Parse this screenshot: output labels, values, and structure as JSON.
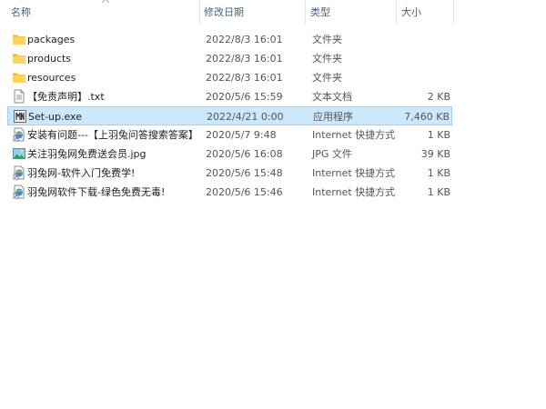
{
  "columns": {
    "name": "名称",
    "modified": "修改日期",
    "type": "类型",
    "size": "大小"
  },
  "files": [
    {
      "name": "packages",
      "modified": "2022/8/3 16:01",
      "type": "文件夹",
      "size": "",
      "icon": "folder-icon",
      "selected": false
    },
    {
      "name": "products",
      "modified": "2022/8/3 16:01",
      "type": "文件夹",
      "size": "",
      "icon": "folder-icon",
      "selected": false
    },
    {
      "name": "resources",
      "modified": "2022/8/3 16:01",
      "type": "文件夹",
      "size": "",
      "icon": "folder-icon",
      "selected": false
    },
    {
      "name": "【免责声明】.txt",
      "modified": "2020/5/6 15:59",
      "type": "文本文档",
      "size": "2 KB",
      "icon": "text-file-icon",
      "selected": false
    },
    {
      "name": "Set-up.exe",
      "modified": "2022/4/21 0:00",
      "type": "应用程序",
      "size": "7,460 KB",
      "icon": "exe-icon",
      "selected": true
    },
    {
      "name": "安装有问题---【上羽兔问答搜索答案】",
      "modified": "2020/5/7 9:48",
      "type": "Internet 快捷方式",
      "size": "1 KB",
      "icon": "internet-shortcut-icon",
      "selected": false
    },
    {
      "name": "关注羽兔网免费送会员.jpg",
      "modified": "2020/5/6 16:08",
      "type": "JPG 文件",
      "size": "39 KB",
      "icon": "image-file-icon",
      "selected": false
    },
    {
      "name": "羽兔网-软件入门免费学!",
      "modified": "2020/5/6 15:48",
      "type": "Internet 快捷方式",
      "size": "1 KB",
      "icon": "internet-shortcut-icon",
      "selected": false
    },
    {
      "name": "羽兔网软件下载-绿色免费无毒!",
      "modified": "2020/5/6 15:46",
      "type": "Internet 快捷方式",
      "size": "1 KB",
      "icon": "internet-shortcut-icon",
      "selected": false
    }
  ],
  "colors": {
    "selection_bg": "#cce8ff",
    "selection_border": "#99d1ff",
    "header_text": "#4c607a",
    "folder": "#ffd35c"
  }
}
